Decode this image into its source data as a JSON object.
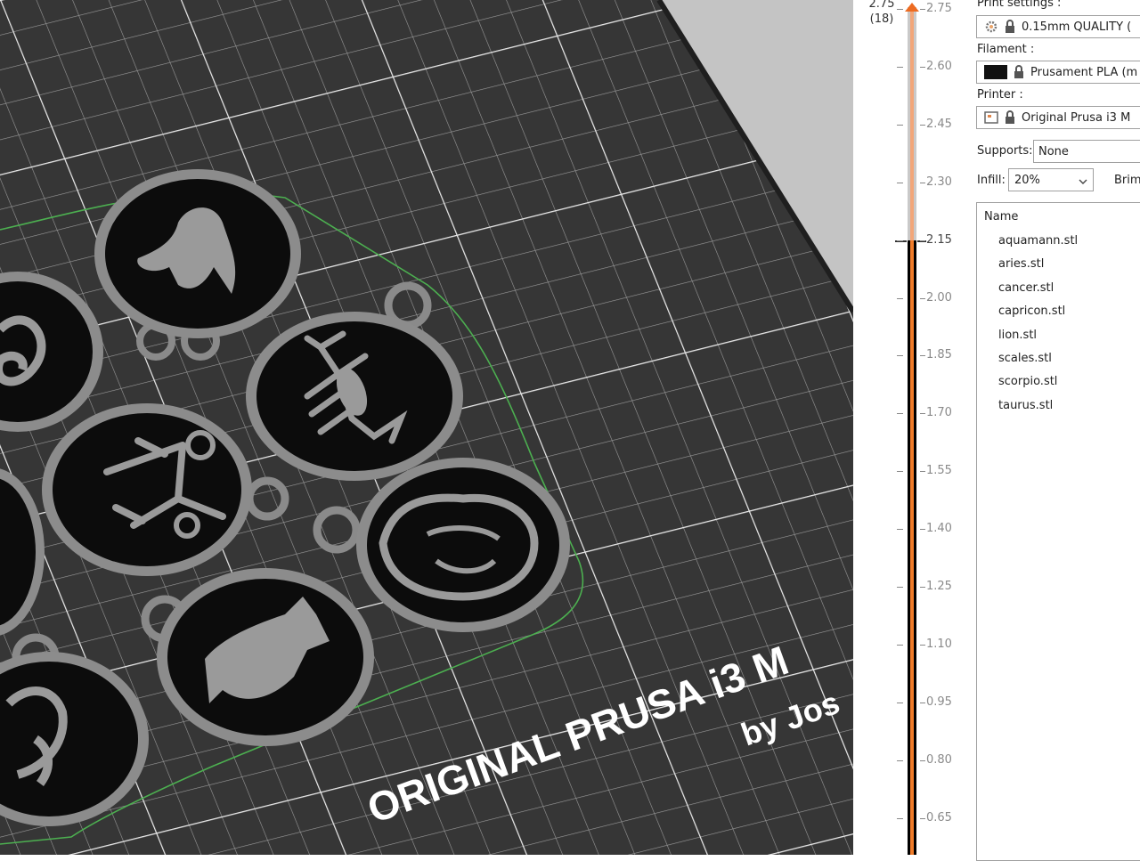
{
  "viewport": {
    "bed_text_line1": "ORIGINAL PRUSA i3 M",
    "bed_text_line2": "by Jos"
  },
  "layer_slider": {
    "top_value": "2.75",
    "top_layer": "(18)",
    "selected_value": "2.15",
    "tick_labels": [
      "2.75",
      "2.60",
      "2.45",
      "2.30",
      "2.15",
      "2.00",
      "1.85",
      "1.70",
      "1.55",
      "1.40",
      "1.25",
      "1.10",
      "0.95",
      "0.80",
      "0.65"
    ]
  },
  "sidebar": {
    "print_settings_label": "Print settings :",
    "print_settings_value": "0.15mm QUALITY (",
    "filament_label": "Filament :",
    "filament_value": "Prusament PLA (m",
    "filament_color": "#111111",
    "printer_label": "Printer :",
    "printer_value": "Original Prusa i3 M",
    "supports_label": "Supports:",
    "supports_value": "None",
    "infill_label": "Infill:",
    "infill_value": "20%",
    "brim_label": "Brim",
    "object_list": {
      "header": "Name",
      "items": [
        "aquamann.stl",
        "aries.stl",
        "cancer.stl",
        "capricon.stl",
        "lion.stl",
        "scales.stl",
        "scorpio.stl",
        "taurus.stl"
      ]
    }
  },
  "colors": {
    "accent": "#ed6b21",
    "bed": "#3a3a3a",
    "object_outline": "#4caf50"
  }
}
